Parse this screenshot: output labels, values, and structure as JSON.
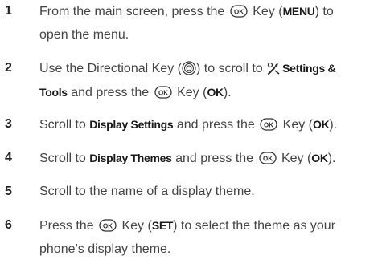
{
  "steps": [
    {
      "number": "1",
      "line1_a": "From the main screen, press the ",
      "line1_b": " Key (",
      "line1_key": "MENU",
      "line1_c": ") to",
      "line2": "open the menu."
    },
    {
      "number": "2",
      "line1_a": "Use the Directional Key (",
      "line1_b": ") to scroll to ",
      "line1_key": "Settings &",
      "line2_key": "Tools",
      "line2_a": " and press the ",
      "line2_b": " Key (",
      "line2_key2": "OK",
      "line2_c": ")."
    },
    {
      "number": "3",
      "line1_a": "Scroll to ",
      "line1_key": "Display Settings",
      "line1_b": " and press the ",
      "line1_c": " Key (",
      "line1_key2": "OK",
      "line1_d": ")."
    },
    {
      "number": "4",
      "line1_a": "Scroll to ",
      "line1_key": "Display Themes",
      "line1_b": " and press the ",
      "line1_c": " Key (",
      "line1_key2": "OK",
      "line1_d": ")."
    },
    {
      "number": "5",
      "line1_a": "Scroll to the name of a display theme."
    },
    {
      "number": "6",
      "line1_a": "Press the ",
      "line1_b": " Key (",
      "line1_key": "SET",
      "line1_c": ") to select the theme as your",
      "line2": "phone’s display theme."
    }
  ],
  "icons": {
    "ok_key": "ok-key-icon",
    "directional_key": "directional-key-icon",
    "settings_tools": "settings-tools-icon"
  },
  "colors": {
    "text": "#444444",
    "key_text": "#1a1a1a",
    "number": "#222222"
  }
}
